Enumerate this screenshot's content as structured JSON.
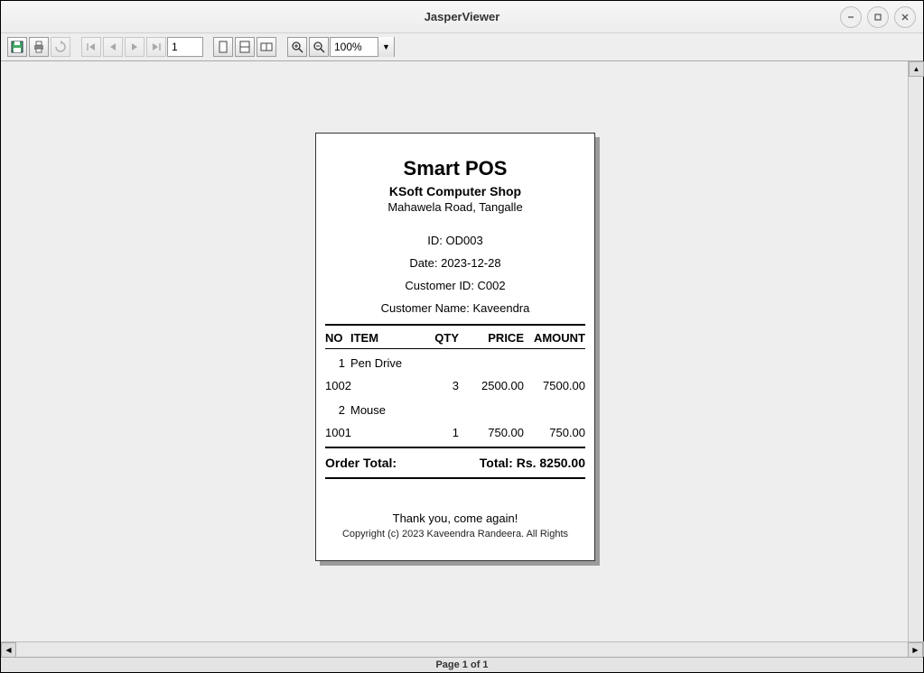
{
  "window": {
    "title": "JasperViewer"
  },
  "toolbar": {
    "page_value": "1",
    "zoom_value": "100%"
  },
  "status": {
    "text": "Page 1 of 1"
  },
  "receipt": {
    "title": "Smart POS",
    "shop": "KSoft Computer Shop",
    "address": "Mahawela Road, Tangalle",
    "id_line": "ID: OD003",
    "date_line": "Date: 2023-12-28",
    "cust_id_line": "Customer ID: C002",
    "cust_name_line": "Customer Name: Kaveendra",
    "headers": {
      "no": "NO",
      "item": "ITEM",
      "qty": "QTY",
      "price": "PRICE",
      "amount": "AMOUNT"
    },
    "rows": [
      {
        "no": "1",
        "item": "Pen Drive",
        "code": "1002",
        "qty": "3",
        "price": "2500.00",
        "amount": "7500.00"
      },
      {
        "no": "2",
        "item": "Mouse",
        "code": "1001",
        "qty": "1",
        "price": "750.00",
        "amount": "750.00"
      }
    ],
    "total_label": "Order Total:",
    "total_value": "Total: Rs. 8250.00",
    "thanks": "Thank you, come again!",
    "copyright": "Copyright (c) 2023 Kaveendra Randeera. All Rights"
  }
}
